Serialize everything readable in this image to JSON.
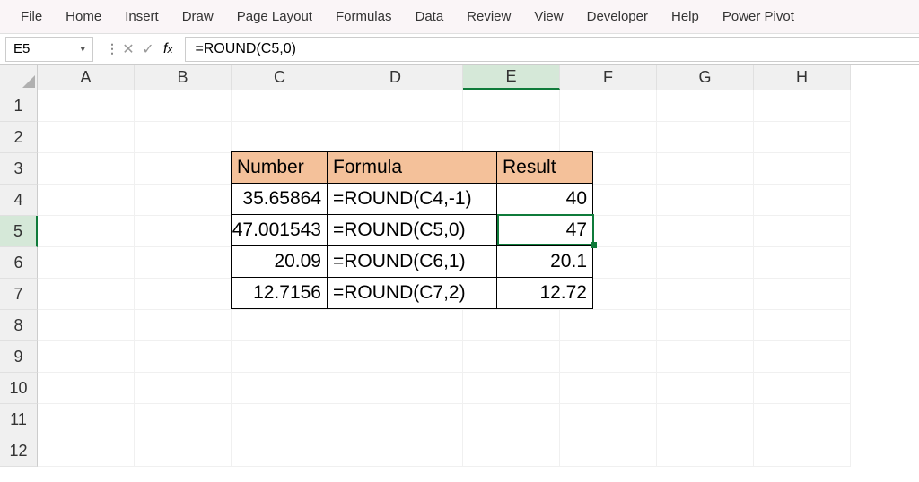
{
  "ribbon": {
    "tabs": [
      "File",
      "Home",
      "Insert",
      "Draw",
      "Page Layout",
      "Formulas",
      "Data",
      "Review",
      "View",
      "Developer",
      "Help",
      "Power Pivot"
    ]
  },
  "formulaBar": {
    "nameBox": "E5",
    "formula": "=ROUND(C5,0)"
  },
  "columns": [
    "A",
    "B",
    "C",
    "D",
    "E",
    "F",
    "G",
    "H"
  ],
  "rows": [
    "1",
    "2",
    "3",
    "4",
    "5",
    "6",
    "7",
    "8",
    "9",
    "10",
    "11",
    "12"
  ],
  "activeCol": "E",
  "activeRow": "5",
  "table": {
    "headers": {
      "c": "Number",
      "d": "Formula",
      "e": "Result"
    },
    "data": [
      {
        "c": "35.65864",
        "d": "=ROUND(C4,-1)",
        "e": "40"
      },
      {
        "c": "47.001543",
        "d": "=ROUND(C5,0)",
        "e": "47"
      },
      {
        "c": "20.09",
        "d": "=ROUND(C6,1)",
        "e": "20.1"
      },
      {
        "c": "12.7156",
        "d": "=ROUND(C7,2)",
        "e": "12.72"
      }
    ]
  }
}
